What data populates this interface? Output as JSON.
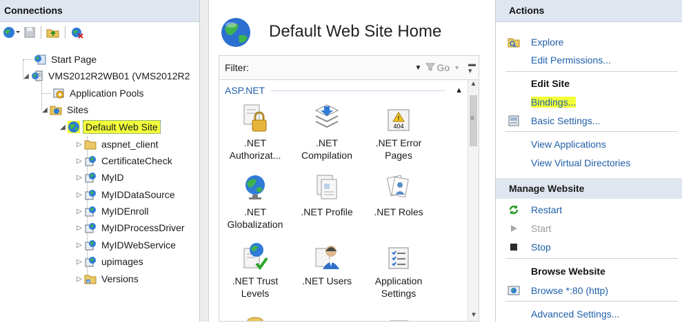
{
  "connections": {
    "title": "Connections",
    "tree": [
      {
        "label": "Start Page",
        "icon": "start-page-icon"
      },
      {
        "label": "VMS2012R2WB01 (VMS2012R2",
        "icon": "server-icon"
      },
      {
        "label": "Application Pools",
        "icon": "app-pools-icon"
      },
      {
        "label": "Sites",
        "icon": "sites-folder-icon"
      },
      {
        "label": "Default Web Site",
        "icon": "website-globe-icon",
        "highlighted": true
      },
      {
        "label": "aspnet_client",
        "icon": "folder-icon"
      },
      {
        "label": "CertificateCheck",
        "icon": "web-app-icon"
      },
      {
        "label": "MyID",
        "icon": "web-app-icon"
      },
      {
        "label": "MyIDDataSource",
        "icon": "web-app-icon"
      },
      {
        "label": "MyIDEnroll",
        "icon": "web-app-icon"
      },
      {
        "label": "MyIDProcessDriver",
        "icon": "web-app-icon"
      },
      {
        "label": "MyIDWebService",
        "icon": "web-app-icon"
      },
      {
        "label": "upimages",
        "icon": "web-app-icon"
      },
      {
        "label": "Versions",
        "icon": "virtual-dir-icon"
      }
    ]
  },
  "home": {
    "title": "Default Web Site Home",
    "filter_label": "Filter:",
    "go_label": "Go",
    "group_name": "ASP.NET",
    "features": [
      {
        "line1": ".NET",
        "line2": "Authorizat...",
        "icon": "lock-icon"
      },
      {
        "line1": ".NET",
        "line2": "Compilation",
        "icon": "compilation-icon"
      },
      {
        "line1": ".NET Error",
        "line2": "Pages",
        "icon": "error-page-icon",
        "badge": "404"
      },
      {
        "line1": ".NET",
        "line2": "Globalization",
        "icon": "globalization-icon"
      },
      {
        "line1": ".NET Profile",
        "line2": "",
        "icon": "profile-icon"
      },
      {
        "line1": ".NET Roles",
        "line2": "",
        "icon": "roles-icon"
      },
      {
        "line1": ".NET Trust",
        "line2": "Levels",
        "icon": "trust-levels-icon"
      },
      {
        "line1": ".NET Users",
        "line2": "",
        "icon": "users-icon"
      },
      {
        "line1": "Application",
        "line2": "Settings",
        "icon": "app-settings-icon"
      }
    ]
  },
  "actions": {
    "title": "Actions",
    "explore": "Explore",
    "edit_permissions": "Edit Permissions...",
    "edit_site": "Edit Site",
    "bindings": "Bindings...",
    "basic_settings": "Basic Settings...",
    "view_applications": "View Applications",
    "view_virtual_dirs": "View Virtual Directories",
    "manage_website": "Manage Website",
    "restart": "Restart",
    "start": "Start",
    "stop": "Stop",
    "browse_website": "Browse Website",
    "browse_80": "Browse *:80 (http)",
    "advanced_settings": "Advanced Settings..."
  },
  "colors": {
    "highlight": "#f2ff3b",
    "link": "#1f5faa",
    "header_bg": "#dfe6ef"
  }
}
